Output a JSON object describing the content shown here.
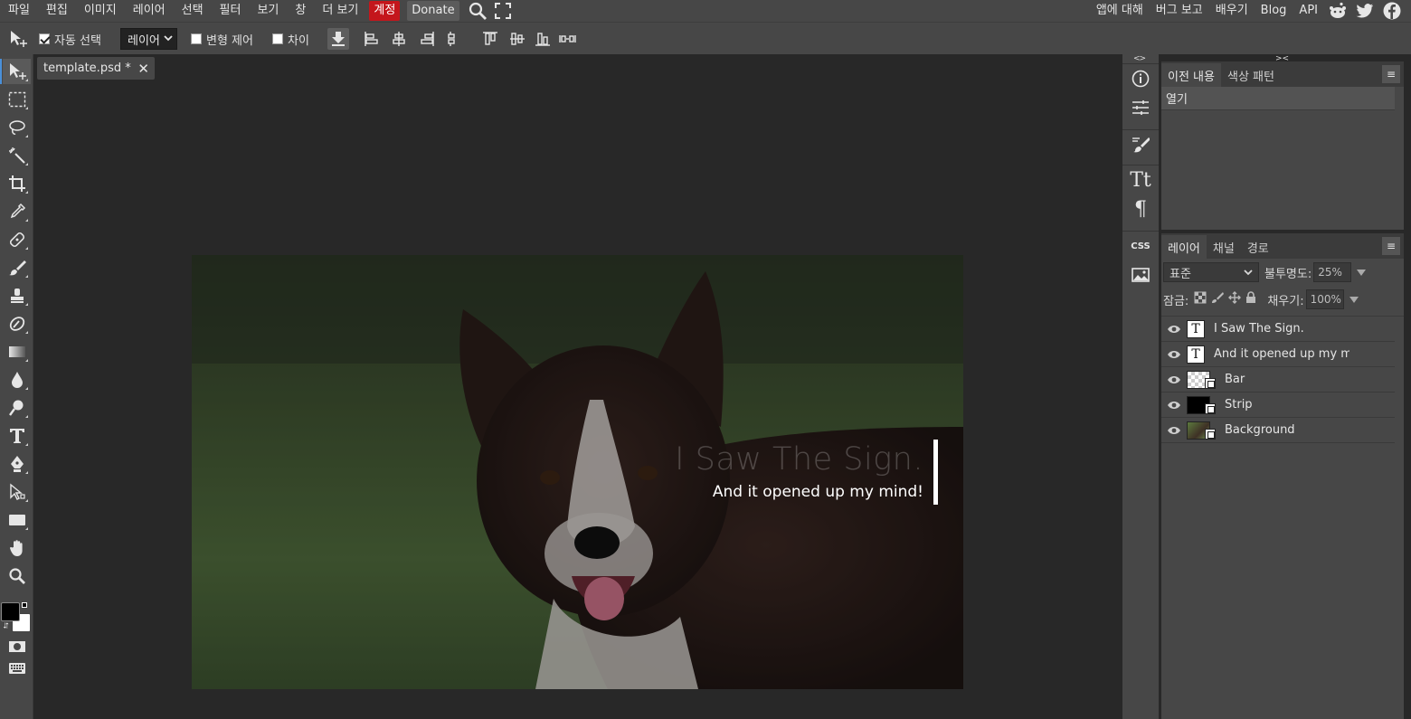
{
  "menubar": {
    "items": [
      "파일",
      "편집",
      "이미지",
      "레이어",
      "선택",
      "필터",
      "보기",
      "창",
      "더 보기"
    ],
    "account": "계정",
    "donate": "Donate",
    "right_links": [
      "앱에 대해",
      "버그 보고",
      "배우기",
      "Blog",
      "API"
    ],
    "social_icons": [
      "reddit-icon",
      "twitter-icon",
      "facebook-icon"
    ],
    "accent_color": "#c4161c"
  },
  "options": {
    "auto_select_label": "자동 선택",
    "auto_select_checked": true,
    "target_select_value": "레이어",
    "transform_label": "변형 제어",
    "transform_checked": false,
    "distance_label": "차이",
    "distance_checked": false
  },
  "document": {
    "tab_name": "template.psd *",
    "title_text": "I Saw The Sign.",
    "subtitle_text": "And it opened up my mind!"
  },
  "panels": {
    "top_tabs": [
      "이전 내용",
      "색상 패턴"
    ],
    "history": [
      "열기"
    ],
    "layer_tabs": [
      "레이어",
      "채널",
      "경로"
    ],
    "blend_mode": "표준",
    "opacity_label": "불투명도:",
    "opacity_value": "25%",
    "lock_label": "잠금:",
    "fill_label": "채우기:",
    "fill_value": "100%",
    "menu_glyph": "≡",
    "layers": [
      {
        "name": "I Saw The Sign.",
        "kind": "text"
      },
      {
        "name": "And it opened up my mir",
        "kind": "text"
      },
      {
        "name": "Bar",
        "kind": "transparent"
      },
      {
        "name": "Strip",
        "kind": "black"
      },
      {
        "name": "Background",
        "kind": "photo"
      }
    ]
  },
  "strip": {
    "css_label": "CSS",
    "collapse_left": "<>",
    "collapse_right": "><"
  }
}
